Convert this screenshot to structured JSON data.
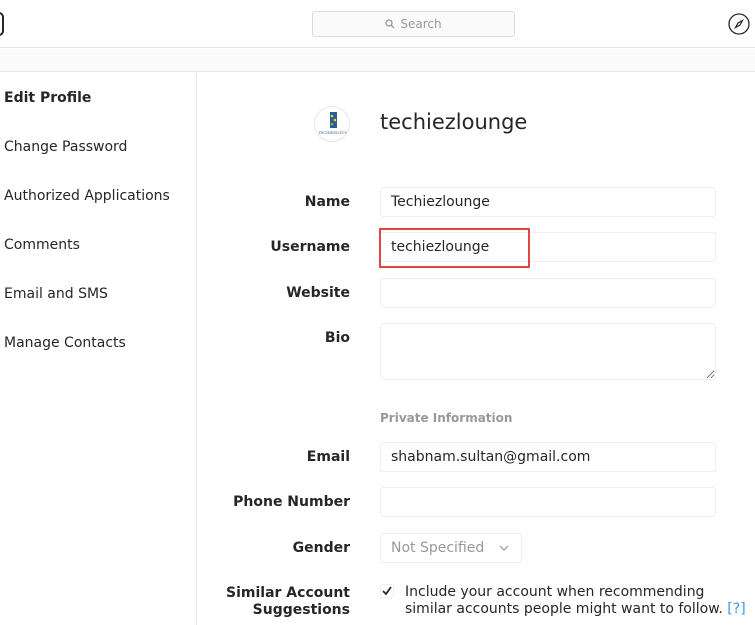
{
  "header": {
    "search_placeholder": "Search",
    "icons": {
      "search": "search-icon",
      "explore": "compass-icon"
    }
  },
  "sidebar": {
    "items": [
      {
        "label": "Edit Profile",
        "active": true
      },
      {
        "label": "Change Password",
        "active": false
      },
      {
        "label": "Authorized Applications",
        "active": false
      },
      {
        "label": "Comments",
        "active": false
      },
      {
        "label": "Email and SMS",
        "active": false
      },
      {
        "label": "Manage Contacts",
        "active": false
      }
    ]
  },
  "profile": {
    "username": "techiezlounge",
    "avatar_text": "TECHIEZLOUN"
  },
  "form": {
    "name": {
      "label": "Name",
      "value": "Techiezlounge"
    },
    "username": {
      "label": "Username",
      "value": "techiezlounge"
    },
    "website": {
      "label": "Website",
      "value": ""
    },
    "bio": {
      "label": "Bio",
      "value": ""
    },
    "private_section_title": "Private Information",
    "email": {
      "label": "Email",
      "value": "shabnam.sultan@gmail.com"
    },
    "phone": {
      "label": "Phone Number",
      "value": ""
    },
    "gender": {
      "label": "Gender",
      "value": "Not Specified"
    },
    "similar": {
      "label_line1": "Similar Account",
      "label_line2": "Suggestions",
      "checked": true,
      "text": "Include your account when recommending similar accounts people might want to follow.",
      "help": "[?]"
    }
  },
  "colors": {
    "highlight": "#e04646",
    "link": "#3897f0",
    "muted": "#999999",
    "border": "#efefef"
  }
}
